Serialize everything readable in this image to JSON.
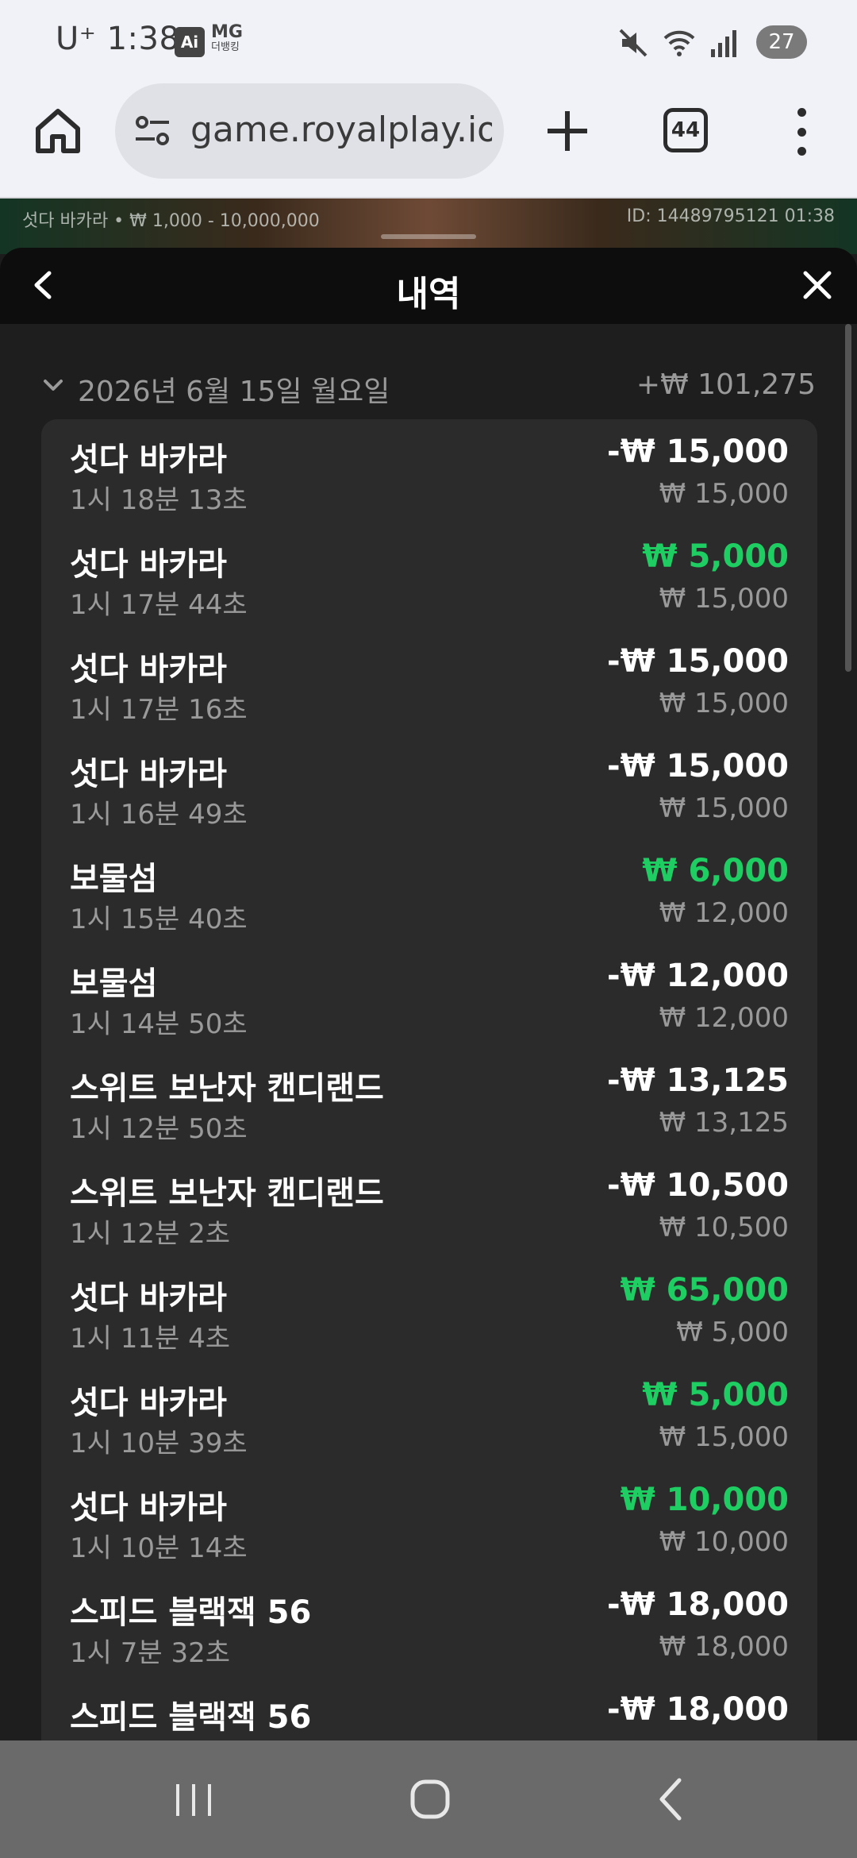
{
  "status_bar": {
    "carrier": "U⁺",
    "time": "1:38",
    "ai_badge": "Ai",
    "mg_label": "MG",
    "mg_sub": "더뱅킹",
    "battery": "27",
    "icons": [
      "mute-icon",
      "wifi-icon",
      "signal-icon"
    ]
  },
  "browser": {
    "url": "game.royalplay.io",
    "tab_count": "44"
  },
  "game_strip": {
    "info": "섯다 바카라 • ₩ 1,000 - 10,000,000",
    "id": "ID: 14489795121 01:38"
  },
  "sheet": {
    "title": "내역",
    "date": "2026년 6월 15일 월요일",
    "date_total": "+₩ 101,275",
    "rows": [
      {
        "name": "섯다 바카라",
        "time": "1시 18분 13초",
        "amount": "-₩ 15,000",
        "bet": "₩ 15,000",
        "win": false
      },
      {
        "name": "섯다 바카라",
        "time": "1시 17분 44초",
        "amount": "₩ 5,000",
        "bet": "₩ 15,000",
        "win": true
      },
      {
        "name": "섯다 바카라",
        "time": "1시 17분 16초",
        "amount": "-₩ 15,000",
        "bet": "₩ 15,000",
        "win": false
      },
      {
        "name": "섯다 바카라",
        "time": "1시 16분 49초",
        "amount": "-₩ 15,000",
        "bet": "₩ 15,000",
        "win": false
      },
      {
        "name": "보물섬",
        "time": "1시 15분 40초",
        "amount": "₩ 6,000",
        "bet": "₩ 12,000",
        "win": true
      },
      {
        "name": "보물섬",
        "time": "1시 14분 50초",
        "amount": "-₩ 12,000",
        "bet": "₩ 12,000",
        "win": false
      },
      {
        "name": "스위트 보난자 캔디랜드",
        "time": "1시 12분 50초",
        "amount": "-₩ 13,125",
        "bet": "₩ 13,125",
        "win": false
      },
      {
        "name": "스위트 보난자 캔디랜드",
        "time": "1시 12분 2초",
        "amount": "-₩ 10,500",
        "bet": "₩ 10,500",
        "win": false
      },
      {
        "name": "섯다 바카라",
        "time": "1시 11분 4초",
        "amount": "₩ 65,000",
        "bet": "₩ 5,000",
        "win": true
      },
      {
        "name": "섯다 바카라",
        "time": "1시 10분 39초",
        "amount": "₩ 5,000",
        "bet": "₩ 15,000",
        "win": true
      },
      {
        "name": "섯다 바카라",
        "time": "1시 10분 14초",
        "amount": "₩ 10,000",
        "bet": "₩ 10,000",
        "win": true
      },
      {
        "name": "스피드 블랙잭 56",
        "time": "1시 7분 32초",
        "amount": "-₩ 18,000",
        "bet": "₩ 18,000",
        "win": false
      },
      {
        "name": "스피드 블랙잭 56",
        "time": "",
        "amount": "-₩ 18,000",
        "bet": "",
        "win": false
      }
    ]
  },
  "colors": {
    "win": "#1fce62",
    "loss": "#ffffff",
    "card_bg": "#2b2b2b",
    "sheet_bg": "#1e1e1e"
  }
}
